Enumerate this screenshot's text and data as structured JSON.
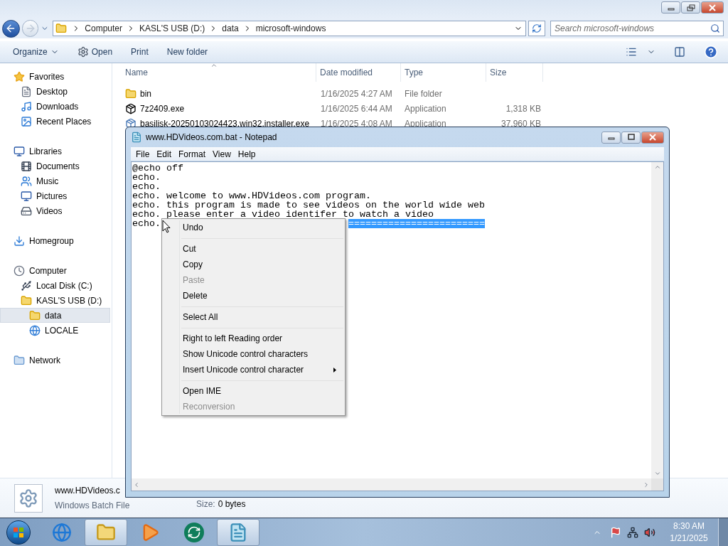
{
  "explorer": {
    "path": [
      "Computer",
      "KASL'S USB (D:)",
      "data",
      "microsoft-windows"
    ],
    "search": {
      "placeholder": "Search microsoft-windows"
    },
    "toolbar": [
      {
        "label": "Organize",
        "dropdown": true
      },
      {
        "label": "Open",
        "dropdown": false
      },
      {
        "label": "Print",
        "dropdown": false
      },
      {
        "label": "New folder",
        "dropdown": false
      }
    ],
    "nav": [
      {
        "label": "Favorites",
        "selected": false,
        "children": [
          {
            "label": "Desktop",
            "selected": false
          },
          {
            "label": "Downloads",
            "selected": false
          },
          {
            "label": "Recent Places",
            "selected": false
          }
        ]
      },
      {
        "label": "Libraries",
        "selected": false,
        "children": [
          {
            "label": "Documents",
            "selected": false
          },
          {
            "label": "Music",
            "selected": false
          },
          {
            "label": "Pictures",
            "selected": false
          },
          {
            "label": "Videos",
            "selected": false
          }
        ]
      },
      {
        "label": "Homegroup",
        "selected": false
      },
      {
        "label": "Computer",
        "selected": false,
        "children": [
          {
            "label": "Local Disk (C:)",
            "selected": false
          },
          {
            "label": "KASL'S USB (D:)",
            "selected": false,
            "children": [
              {
                "label": "data",
                "selected": true
              },
              {
                "label": "LOCALE",
                "selected": false
              }
            ]
          }
        ]
      },
      {
        "label": "Network",
        "selected": false
      }
    ],
    "columns": [
      "Name",
      "Date modified",
      "Type",
      "Size"
    ],
    "rows": [
      {
        "name": "bin",
        "date": "1/16/2025 4:27 AM",
        "type": "File folder"
      },
      {
        "name": "7z2409.exe",
        "date": "1/16/2025 6:44 AM",
        "type": "Application",
        "size": "1,318 KB"
      },
      {
        "name": "basilisk-20250103024423.win32.installer.exe",
        "date": "1/16/2025 4:08 AM",
        "type": "Application",
        "size": "37,960 KB"
      }
    ],
    "details": {
      "name": "www.HDVideos.c",
      "type": "Windows Batch File",
      "size_label": "Size:",
      "size": "0 bytes"
    }
  },
  "notepad": {
    "title": "www.HDVideos.com.bat - Notepad",
    "menu": [
      "File",
      "Edit",
      "Format",
      "View",
      "Help"
    ],
    "lines": [
      "@echo off",
      "echo.",
      "echo.",
      "echo. welcome to www.HDVideos.com program.",
      "echo. this program is made to see videos on the world wide web",
      "echo. please enter a video identifer to watch a video",
      "echo."
    ],
    "selection": "========================"
  },
  "context_menu": [
    {
      "kind": "item",
      "label": "Undo",
      "disabled": false,
      "submenu": false
    },
    {
      "kind": "separator"
    },
    {
      "kind": "item",
      "label": "Cut",
      "disabled": false,
      "submenu": false
    },
    {
      "kind": "item",
      "label": "Copy",
      "disabled": false,
      "submenu": false
    },
    {
      "kind": "item",
      "label": "Paste",
      "disabled": true,
      "submenu": false
    },
    {
      "kind": "item",
      "label": "Delete",
      "disabled": false,
      "submenu": false
    },
    {
      "kind": "separator"
    },
    {
      "kind": "item",
      "label": "Select All",
      "disabled": false,
      "submenu": false
    },
    {
      "kind": "separator"
    },
    {
      "kind": "item",
      "label": "Right to left Reading order",
      "disabled": false,
      "submenu": false
    },
    {
      "kind": "item",
      "label": "Show Unicode control characters",
      "disabled": false,
      "submenu": false
    },
    {
      "kind": "item",
      "label": "Insert Unicode control character",
      "disabled": false,
      "submenu": true
    },
    {
      "kind": "separator"
    },
    {
      "kind": "item",
      "label": "Open IME",
      "disabled": false,
      "submenu": false
    },
    {
      "kind": "item",
      "label": "Reconversion",
      "disabled": true,
      "submenu": false
    }
  ],
  "taskbar": {
    "apps": [
      {
        "selected": false
      },
      {
        "selected": true
      },
      {
        "selected": false
      },
      {
        "selected": false
      },
      {
        "selected": true
      }
    ],
    "clock": {
      "time": "8:30 AM",
      "date": "1/21/2025"
    }
  }
}
